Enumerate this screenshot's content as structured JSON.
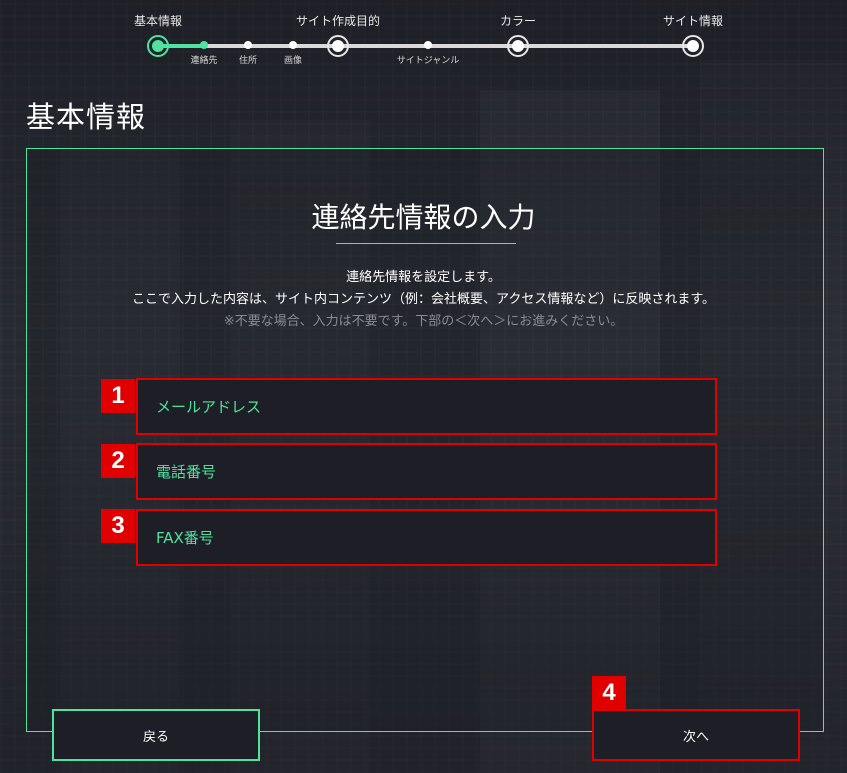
{
  "stepper": {
    "steps": [
      "基本情報",
      "サイト作成目的",
      "カラー",
      "サイト情報"
    ],
    "substeps": [
      "連絡先",
      "住所",
      "画像",
      "サイトジャンル"
    ],
    "accent_color": "#4fe3a0"
  },
  "page": {
    "title": "基本情報"
  },
  "section": {
    "title": "連絡先情報の入力",
    "desc_line1": "連絡先情報を設定します。",
    "desc_line2": "ここで入力した内容は、サイト内コンテンツ（例：会社概要、アクセス情報など）に反映されます。",
    "note": "※不要な場合、入力は不要です。下部の＜次へ＞にお進みください。"
  },
  "fields": {
    "email": {
      "placeholder": "メールアドレス",
      "value": ""
    },
    "phone": {
      "placeholder": "電話番号",
      "value": ""
    },
    "fax": {
      "placeholder": "FAX番号",
      "value": ""
    }
  },
  "annotations": [
    "1",
    "2",
    "3",
    "4"
  ],
  "buttons": {
    "back": "戻る",
    "next": "次へ"
  },
  "highlight_color": "#e00000"
}
